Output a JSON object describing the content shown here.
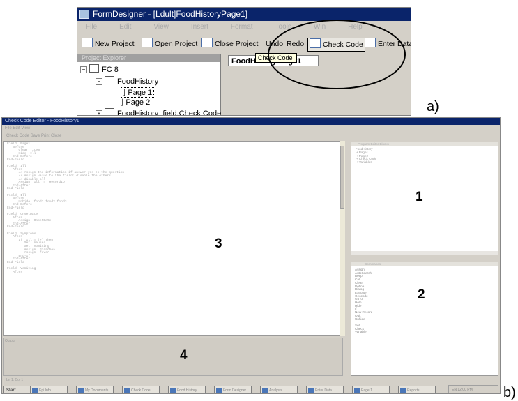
{
  "figure_a": {
    "label": "a)",
    "window_title": "FormDesigner - [Ldult]FoodHistoryPage1]",
    "menu": [
      "File",
      "Edit",
      "View",
      "Insert",
      "Format",
      "Tools",
      "Win",
      "Help"
    ],
    "toolbar": {
      "new_project": "New Project",
      "open_project": "Open Project",
      "close_project": "Close Project",
      "undo": "Undo",
      "redo": "Redo",
      "check_code": "Check Code",
      "enter_data": "Enter Data"
    },
    "tooltip": "Check Code",
    "left_panel_header": "Project Explorer",
    "tree": {
      "root": "FC 8",
      "view": "FoodHistory",
      "page1": "Page 1",
      "page2": "Page 2",
      "check_code": "FoodHistory_field.Check Code"
    },
    "doc_tab": "FoodHistory/Page1"
  },
  "figure_b": {
    "label": "b)",
    "window_title": "Check Code Editor - FoodHistory1",
    "menu": "File  Edit  View",
    "toolbar": "Check Code  Save  Print  Close",
    "code_lines": [
      "Field  Page1",
      "   Before",
      "      Clear  item",
      "      Hide  Ill",
      "   End-Before",
      "End-Field",
      "",
      "Field  Ill",
      "   After",
      "      // Assign the information if answer yes to the question",
      "      // Assign value to the field; disable the others",
      "      // disable all",
      "      Assign  Ill  =  RecordID",
      "   End-After",
      "End-Field",
      "",
      "Field  Ill",
      "   Before",
      "      Unhide  food1 food2 food3",
      "   End-Before",
      "End-Field",
      "",
      "Field  OnsetDate",
      "   After",
      "      Assign  OnsetDate",
      "   End-After",
      "End-Field",
      "",
      "Field  Symptoms",
      "   After",
      "      If  Ill = (+) Then",
      "         Set  nausea",
      "         Set  vomiting",
      "         Assign  diarrhea",
      "         Assign  fever",
      "      End-If",
      "   End-After",
      "End-Field",
      "",
      "Field  Vomiting",
      "   After"
    ],
    "output_header": "Output",
    "panel1_header": "Program Editor Blocks",
    "panel1_tree": [
      "- FoodHistory",
      "   + Page1",
      "   + Page2",
      "   + Check Code",
      "   + Variables"
    ],
    "panel2_header": "Commands",
    "panel2_list": [
      "Assign",
      "AutoSearch",
      "Beep",
      "Call",
      "Clear",
      "Define",
      "Dialog",
      "Execute",
      "Geocode",
      "GoTo",
      "Help",
      "Hide",
      "If",
      "New Record",
      "Quit",
      "Unhide",
      "",
      "Set",
      "Check",
      "Variable"
    ],
    "region_labels": {
      "panel1": "1",
      "panel2": "2",
      "editor": "3",
      "output": "4"
    },
    "status_bar": "Ln 1, Col 1",
    "taskbar": {
      "start": "Start",
      "items": [
        "Epi Info",
        "My Documents",
        "Check Code",
        "Food History",
        "Form Designer",
        "Analysis",
        "Enter Data",
        "Page 1",
        "Reports"
      ],
      "tray": "EN  12:00 PM"
    }
  }
}
